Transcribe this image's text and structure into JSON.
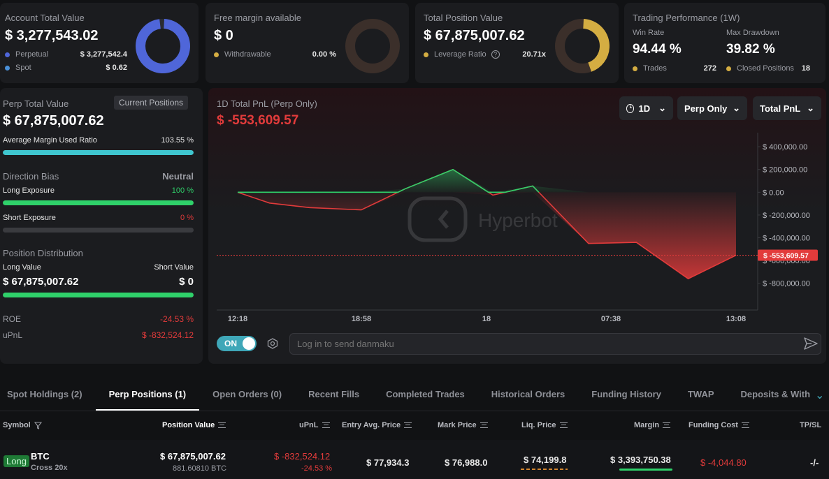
{
  "summary": {
    "account": {
      "label": "Account Total Value",
      "value": "$ 3,277,543.02",
      "rows": [
        {
          "label": "Perpetual",
          "value": "$ 3,277,542.4",
          "color": "#4f66d9"
        },
        {
          "label": "Spot",
          "value": "$ 0.62",
          "color": "#4a90d9"
        }
      ],
      "donut_fraction": 1.0,
      "donut_color": "#4f66d9"
    },
    "margin": {
      "label": "Free margin available",
      "value": "$ 0",
      "rows": [
        {
          "label": "Withdrawable",
          "value": "0.00 %",
          "color": "#d4ad42"
        }
      ],
      "donut_fraction": 0.0,
      "donut_color": "#3b2f2a"
    },
    "position": {
      "label": "Total Position Value",
      "value": "$ 67,875,007.62",
      "rows": [
        {
          "label": "Leverage Ratio",
          "value": "20.71x",
          "color": "#d4ad42"
        }
      ],
      "donut_fraction": 0.45,
      "donut_color": "#d4ad42"
    },
    "performance": {
      "label": "Trading Performance (1W)",
      "win_rate_label": "Win Rate",
      "win_rate": "94.44 %",
      "drawdown_label": "Max Drawdown",
      "drawdown": "39.82 %",
      "trades_label": "Trades",
      "trades": "272",
      "closed_label": "Closed Positions",
      "closed": "18",
      "dot_color": "#d4ad42"
    }
  },
  "perp": {
    "title": "Perp Total Value",
    "button": "Current Positions",
    "value": "$ 67,875,007.62",
    "margin_ratio_label": "Average Margin Used Ratio",
    "margin_ratio": "103.55 %",
    "margin_ratio_fraction": 1.0,
    "bias_label": "Direction Bias",
    "bias": "Neutral",
    "long_exposure_label": "Long Exposure",
    "long_exposure": "100 %",
    "long_fraction": 1.0,
    "short_exposure_label": "Short Exposure",
    "short_exposure": "0 %",
    "short_fraction": 0.0,
    "distribution_label": "Position Distribution",
    "long_value_label": "Long Value",
    "short_value_label": "Short Value",
    "long_value": "$ 67,875,007.62",
    "short_value": "$ 0",
    "long_share": 1.0,
    "roe_label": "ROE",
    "roe": "-24.53 %",
    "upnl_label": "uPnL",
    "upnl": "$ -832,524.12"
  },
  "pnl": {
    "title": "1D Total PnL (Perp Only)",
    "value": "$ -553,609.57",
    "dropdowns": [
      "1D",
      "Perp Only",
      "Total PnL"
    ],
    "watermark": "Hyperbot",
    "danmaku_toggle": "ON",
    "danmaku_placeholder": "Log in to send danmaku"
  },
  "chart_data": {
    "type": "area",
    "x_ticks": [
      "12:18",
      "18:58",
      "18",
      "07:38",
      "13:08"
    ],
    "y_ticks": [
      "$ 400,000.00",
      "$ 200,000.00",
      "$ 0.00",
      "$ -200,000.00",
      "$ -400,000.00",
      "$ -600,000.00",
      "$ -800,000.00"
    ],
    "ylim": [
      -900000,
      450000
    ],
    "x": [
      0,
      0.08,
      0.18,
      0.31,
      0.42,
      0.54,
      0.64,
      0.74,
      0.88,
      1.0,
      1.13,
      1.25
    ],
    "values": [
      0,
      -95000,
      -135000,
      -155000,
      30000,
      200000,
      -25000,
      55000,
      -450000,
      -440000,
      -760000,
      -553609.57
    ],
    "current_label": "$ -553,609.57"
  },
  "tabs": [
    "Spot Holdings (2)",
    "Perp Positions (1)",
    "Open Orders (0)",
    "Recent Fills",
    "Completed Trades",
    "Historical Orders",
    "Funding History",
    "TWAP",
    "Deposits & Withdraw"
  ],
  "active_tab": 1,
  "table": {
    "headers": {
      "symbol": "Symbol",
      "position_value": "Position Value",
      "upnl": "uPnL",
      "entry": "Entry Avg. Price",
      "mark": "Mark Price",
      "liq": "Liq. Price",
      "margin": "Margin",
      "funding": "Funding Cost",
      "tpsl": "TP/SL"
    },
    "row": {
      "side": "Long",
      "symbol": "BTC",
      "mode": "Cross 20x",
      "position_value": "$ 67,875,007.62",
      "size": "881.60810 BTC",
      "upnl": "$ -832,524.12",
      "upnl_pct": "-24.53 %",
      "entry": "$ 77,934.3",
      "mark": "$ 76,988.0",
      "liq": "$ 74,199.8",
      "margin": "$ 3,393,750.38",
      "funding": "$ -4,044.80",
      "tpsl": "-/-"
    }
  }
}
